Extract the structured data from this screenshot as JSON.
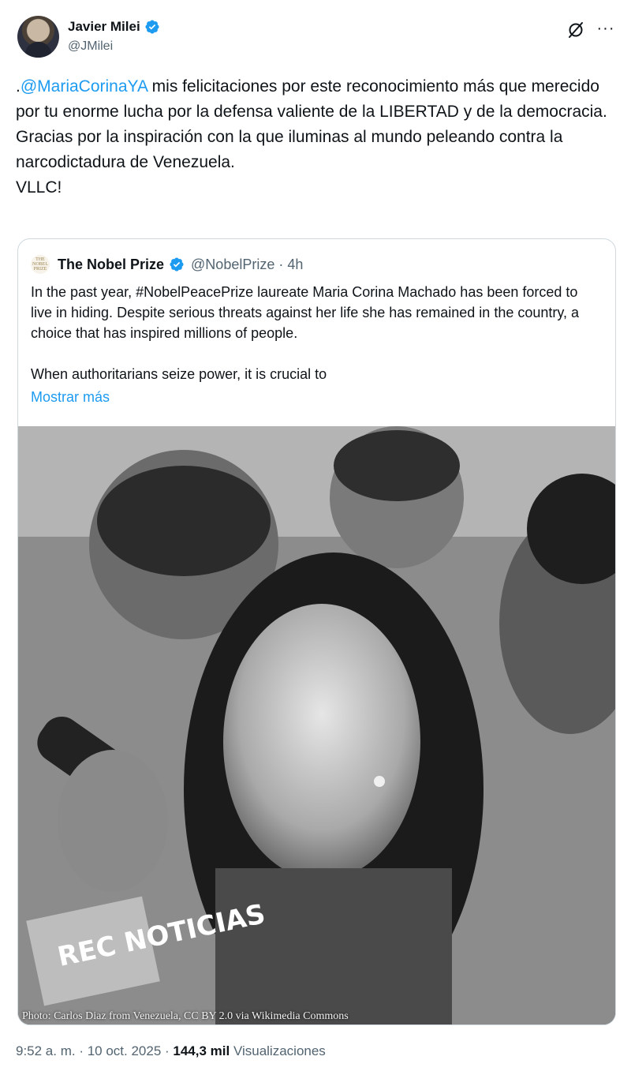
{
  "author": {
    "name": "Javier Milei",
    "handle": "@JMilei",
    "verified_color": "#1d9bf0"
  },
  "icons": {
    "grok": "grok-icon",
    "more": "more-icon",
    "verified": "verified-badge-icon"
  },
  "tweet": {
    "mention": "@MariaCorinaYA",
    "prefix": ".",
    "body": " mis felicitaciones por este reconocimiento más que merecido por tu enorme lucha por la defensa valiente de la LIBERTAD y de la democracia.\nGracias por la inspiración con la que iluminas al mundo peleando contra la narcodictadura de Venezuela.\nVLLC!"
  },
  "quote": {
    "logo_text": "THE NOBEL PRIZE",
    "name": "The Nobel Prize",
    "handle": "@NobelPrize · 4h",
    "text": "In the past year, #NobelPeacePrize laureate Maria Corina Machado has been forced to live in hiding. Despite serious threats against her life she has remained in the country, a choice that has inspired millions of people.\n\nWhen authoritarians seize power, it is crucial to",
    "show_more": "Mostrar más",
    "photo_caption": "Photo: Carlos Diaz from Venezuela, CC BY 2.0 via Wikimedia Commons",
    "photo_sign": "REC NOTICIAS"
  },
  "meta": {
    "time": "9:52 a. m. · 10 oct. 2025 · ",
    "views_count": "144,3 mil",
    "views_label": " Visualizaciones"
  }
}
